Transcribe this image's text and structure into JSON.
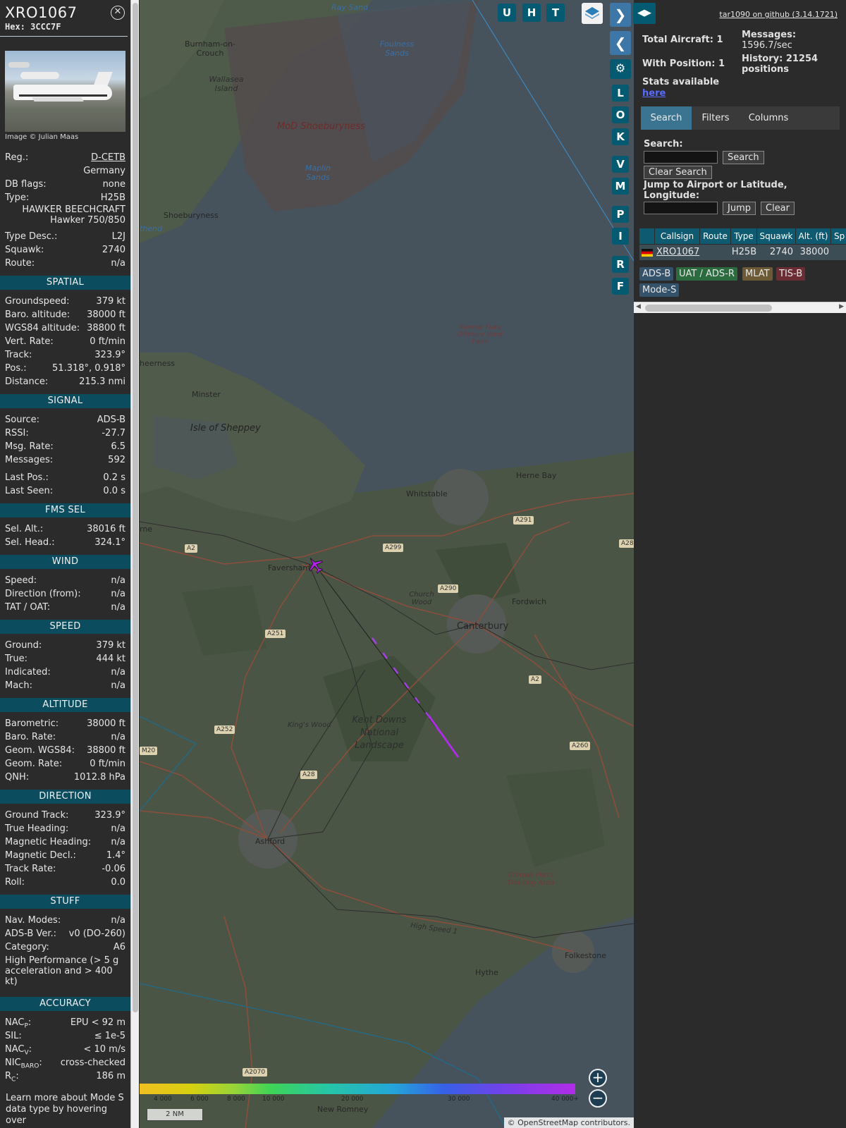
{
  "aircraft": {
    "callsign": "XRO1067",
    "hex_line": "Hex: 3CCC7F",
    "photo_credit": "Image © Julian Maas",
    "reg_label": "Reg.:",
    "reg_value": "D-CETB",
    "country": "Germany",
    "dbflags_label": "DB flags:",
    "dbflags_value": "none",
    "type_label": "Type:",
    "type_value": "H25B",
    "type_name_1": "HAWKER BEECHCRAFT",
    "type_name_2": "Hawker 750/850",
    "typedesc_label": "Type Desc.:",
    "typedesc_value": "L2J",
    "squawk_label": "Squawk:",
    "squawk_value": "2740",
    "route_label": "Route:",
    "route_value": "n/a"
  },
  "sections": {
    "spatial": "SPATIAL",
    "signal": "SIGNAL",
    "fms": "FMS SEL",
    "wind": "WIND",
    "speed": "SPEED",
    "altitude": "ALTITUDE",
    "direction": "DIRECTION",
    "stuff": "STUFF",
    "accuracy": "ACCURACY"
  },
  "spatial": [
    {
      "k": "Groundspeed:",
      "v": "379 kt"
    },
    {
      "k": "Baro. altitude:",
      "v": "38000 ft"
    },
    {
      "k": "WGS84 altitude:",
      "v": "38800 ft"
    },
    {
      "k": "Vert. Rate:",
      "v": "0 ft/min"
    },
    {
      "k": "Track:",
      "v": "323.9°"
    },
    {
      "k": "Pos.:",
      "v": "51.318°, 0.918°"
    },
    {
      "k": "Distance:",
      "v": "215.3 nmi"
    }
  ],
  "signal": [
    {
      "k": "Source:",
      "v": "ADS-B"
    },
    {
      "k": "RSSI:",
      "v": "-27.7"
    },
    {
      "k": "Msg. Rate:",
      "v": "6.5"
    },
    {
      "k": "Messages:",
      "v": "592"
    },
    {
      "k": "Last Pos.:",
      "v": "0.2 s"
    },
    {
      "k": "Last Seen:",
      "v": "0.0 s"
    }
  ],
  "fms": [
    {
      "k": "Sel. Alt.:",
      "v": "38016 ft"
    },
    {
      "k": "Sel. Head.:",
      "v": "324.1°"
    }
  ],
  "wind": [
    {
      "k": "Speed:",
      "v": "n/a"
    },
    {
      "k": "Direction (from):",
      "v": "n/a"
    },
    {
      "k": "TAT / OAT:",
      "v": "n/a"
    }
  ],
  "speed": [
    {
      "k": "Ground:",
      "v": "379 kt"
    },
    {
      "k": "True:",
      "v": "444 kt"
    },
    {
      "k": "Indicated:",
      "v": "n/a"
    },
    {
      "k": "Mach:",
      "v": "n/a"
    }
  ],
  "altitude": [
    {
      "k": "Barometric:",
      "v": "38000 ft"
    },
    {
      "k": "Baro. Rate:",
      "v": "n/a"
    },
    {
      "k": "Geom. WGS84:",
      "v": "38800 ft"
    },
    {
      "k": "Geom. Rate:",
      "v": "0 ft/min"
    },
    {
      "k": "QNH:",
      "v": "1012.8 hPa"
    }
  ],
  "direction": [
    {
      "k": "Ground Track:",
      "v": "323.9°"
    },
    {
      "k": "True Heading:",
      "v": "n/a"
    },
    {
      "k": "Magnetic Heading:",
      "v": "n/a"
    },
    {
      "k": "Magnetic Decl.:",
      "v": "1.4°"
    },
    {
      "k": "Track Rate:",
      "v": "-0.06"
    },
    {
      "k": "Roll:",
      "v": "0.0"
    }
  ],
  "stuff": [
    {
      "k": "Nav. Modes:",
      "v": "n/a"
    },
    {
      "k": "ADS-B Ver.:",
      "v": "v0 (DO-260)"
    },
    {
      "k": "Category:",
      "v": "A6"
    }
  ],
  "stuff_perf": "High Performance (> 5 g acceleration and > 400 kt)",
  "accuracy": {
    "nacp_label": "NAC",
    "nacp_sub": "P",
    "nacp_value": "EPU < 92 m",
    "sil_label": "SIL:",
    "sil_value": "≤ 1e-5",
    "nacv_label": "NAC",
    "nacv_sub": "V",
    "nacv_value": "< 10 m/s",
    "nicbaro_label": "NIC",
    "nicbaro_sub": "BARO",
    "nicbaro_value": "cross-checked",
    "rc_label": "R",
    "rc_sub": "C",
    "rc_value": "186 m"
  },
  "footer_note": "Learn more about Mode S data type by hovering over",
  "map": {
    "labels": {
      "ray_sand": "Ray Sand",
      "burnham": "Burnham-on-Crouch",
      "foulness": "Foulness Sands",
      "wallasea": "Wallasea Island",
      "mod": "MoD Shoeburyness",
      "maplin": "Maplin Sands",
      "shoeburyness": "Shoeburyness",
      "thend": "thend",
      "kentish": "Kentish Flats Offshore Wind Farm",
      "sheerness": "heerness",
      "minster": "Minster",
      "sheppey": "Isle of Sheppey",
      "herne": "Herne Bay",
      "whitstable": "Whitstable",
      "rne": "rne",
      "faversham": "Faversham",
      "church_wood": "Church Wood",
      "fordwich": "Fordwich",
      "canterbury": "Canterbury",
      "kings_wood": "King's Wood",
      "kent_downs": "Kent Downs National Landscape",
      "ashford": "Ashford",
      "cinque": "Cinque Ports Training Area",
      "high_speed": "High Speed 1",
      "folkestone": "Folkestone",
      "hythe": "Hythe",
      "new_romney": "New Romney"
    },
    "roads": [
      "A291",
      "A28",
      "A2",
      "A299",
      "A290",
      "A251",
      "A2",
      "A252",
      "M20",
      "A28",
      "A260",
      "A2070"
    ],
    "altitude_ticks": [
      "4 000",
      "6 000",
      "8 000",
      "10 000",
      "20 000",
      "30 000",
      "40 000+"
    ],
    "scale": "2 NM",
    "attribution_prefix": "© ",
    "attribution_link": "OpenStreetMap",
    "attribution_suffix": " contributors.",
    "buttons": {
      "u": "U",
      "h": "H",
      "t": "T",
      "l": "L",
      "o": "O",
      "k": "K",
      "v": "V",
      "m": "M",
      "p": "P",
      "i": "I",
      "r": "R",
      "f": "F"
    },
    "zoom_in": "+",
    "zoom_out": "−"
  },
  "panel": {
    "github": "tar1090 on github (3.14.1721)",
    "total_aircraft": "Total Aircraft: 1",
    "with_position": "With Position: 1",
    "messages_label": "Messages:",
    "messages_value": "1596.7/sec",
    "history_label": "History: 21254",
    "history_value": "positions",
    "stats_available": "Stats available",
    "stats_here": "here",
    "tabs": [
      "Search",
      "Filters",
      "Columns"
    ],
    "search_label": "Search:",
    "search_button": "Search",
    "clear_search": "Clear Search",
    "jump_label_1": "Jump to Airport or Latitude,",
    "jump_label_2": "Longitude:",
    "jump_button": "Jump",
    "clear_button": "Clear",
    "columns": [
      "Callsign",
      "Route",
      "Type",
      "Squawk",
      "Alt. (ft)",
      "Sp"
    ],
    "row": {
      "callsign": "XRO1067",
      "route": "",
      "type": "H25B",
      "squawk": "2740",
      "alt": "38000"
    },
    "legend": [
      "ADS-B",
      "UAT / ADS-R",
      "MLAT",
      "TIS-B",
      "Mode-S"
    ],
    "legend_colors": {
      "adsb": "#35526b",
      "uat": "#2c6b3e",
      "mlat": "#6b5a35",
      "tisb": "#6b2c34",
      "modes": "#35526b"
    }
  }
}
